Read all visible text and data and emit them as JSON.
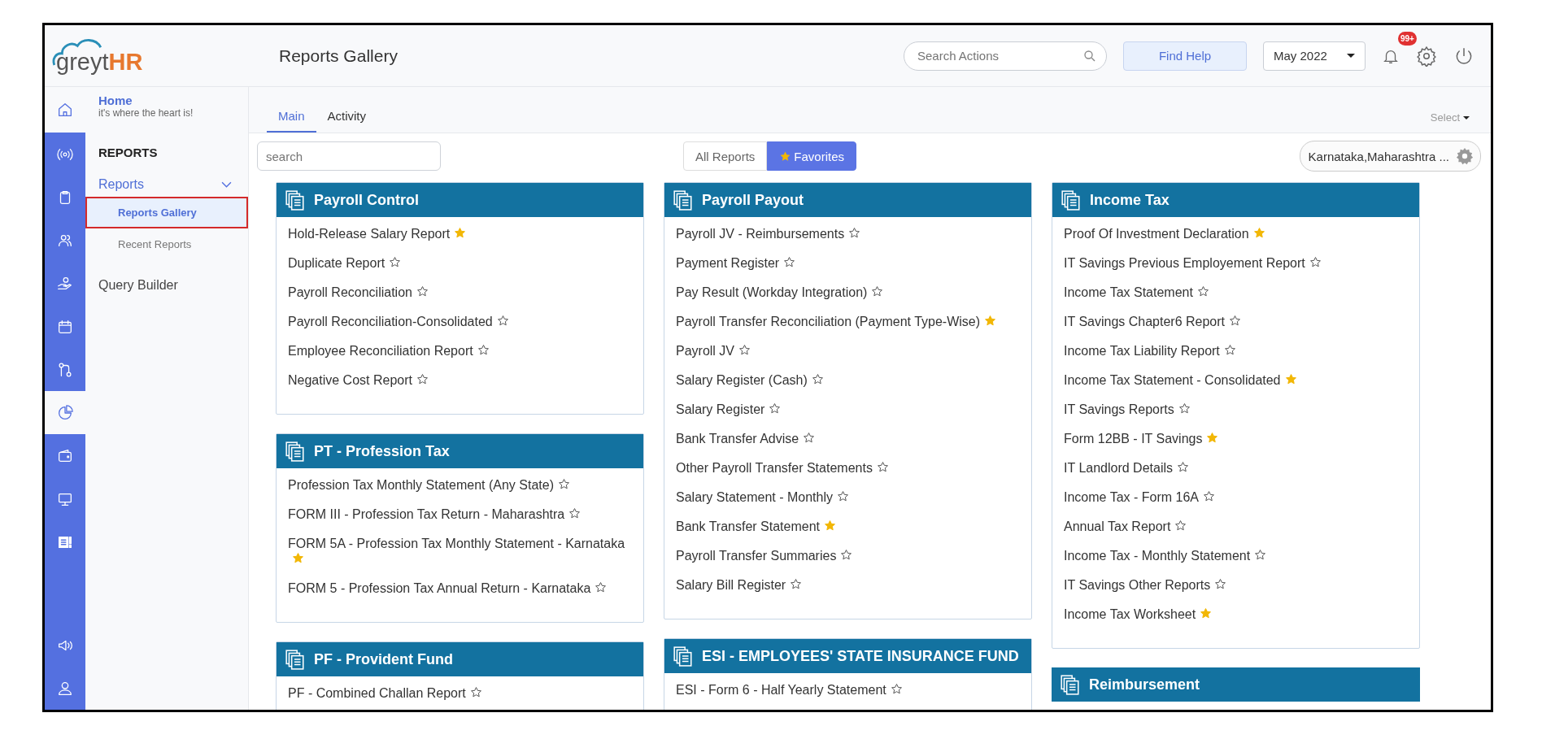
{
  "logo": {
    "part_a": "greyt",
    "part_b": "HR"
  },
  "header": {
    "title": "Reports Gallery",
    "search_placeholder": "Search Actions",
    "help_button": "Find Help",
    "period": "May 2022",
    "notification_badge": "99+"
  },
  "rail_home": {
    "kind": "home"
  },
  "rail": [
    {
      "kind": "broadcast",
      "selected": false
    },
    {
      "kind": "clipboard",
      "selected": false
    },
    {
      "kind": "people",
      "selected": false
    },
    {
      "kind": "hand",
      "selected": false
    },
    {
      "kind": "calendar",
      "selected": false
    },
    {
      "kind": "route",
      "selected": false
    },
    {
      "kind": "pie",
      "selected": true
    },
    {
      "kind": "wallet",
      "selected": false
    },
    {
      "kind": "monitor",
      "selected": false
    },
    {
      "kind": "news",
      "selected": false
    }
  ],
  "rail_bottom": [
    {
      "kind": "megaphone"
    },
    {
      "kind": "user"
    }
  ],
  "sidebar": {
    "home_title": "Home",
    "home_subtitle": "it's where the heart is!",
    "section": "REPORTS",
    "menu": {
      "label": "Reports",
      "expanded": true,
      "children": [
        {
          "label": "Reports Gallery",
          "selected": true
        },
        {
          "label": "Recent Reports",
          "selected": false
        }
      ]
    },
    "links": [
      "Query Builder"
    ]
  },
  "tabs": [
    {
      "label": "Main",
      "selected": true
    },
    {
      "label": "Activity",
      "selected": false
    }
  ],
  "select_menu": "Select",
  "filters": {
    "search_placeholder": "search",
    "toggle": [
      {
        "label": "All Reports",
        "selected": false
      },
      {
        "label": "Favorites",
        "selected": true
      }
    ],
    "location": "Karnataka,Maharashtra ..."
  },
  "columns": [
    [
      {
        "title": "Payroll Control",
        "reports": [
          {
            "name": "Hold-Release Salary Report",
            "favorite": true
          },
          {
            "name": "Duplicate Report",
            "favorite": false
          },
          {
            "name": "Payroll Reconciliation",
            "favorite": false
          },
          {
            "name": "Payroll Reconciliation-Consolidated",
            "favorite": false
          },
          {
            "name": "Employee Reconciliation Report",
            "favorite": false
          },
          {
            "name": "Negative Cost Report",
            "favorite": false
          }
        ]
      },
      {
        "title": "PT - Profession Tax",
        "reports": [
          {
            "name": "Profession Tax Monthly Statement (Any State)",
            "favorite": false
          },
          {
            "name": "FORM III - Profession Tax Return - Maharashtra",
            "favorite": false
          },
          {
            "name": "FORM 5A - Profession Tax Monthly Statement - Karnataka",
            "favorite": true
          },
          {
            "name": "FORM 5 - Profession Tax Annual Return - Karnataka",
            "favorite": false
          }
        ]
      },
      {
        "title": "PF - Provident Fund",
        "reports": [
          {
            "name": "PF - Combined Challan Report",
            "favorite": false
          }
        ]
      }
    ],
    [
      {
        "title": "Payroll Payout",
        "reports": [
          {
            "name": "Payroll JV - Reimbursements",
            "favorite": false
          },
          {
            "name": "Payment Register",
            "favorite": false
          },
          {
            "name": "Pay Result (Workday Integration)",
            "favorite": false
          },
          {
            "name": "Payroll Transfer Reconciliation (Payment Type-Wise)",
            "favorite": true
          },
          {
            "name": "Payroll JV",
            "favorite": false
          },
          {
            "name": "Salary Register (Cash)",
            "favorite": false
          },
          {
            "name": "Salary Register",
            "favorite": false
          },
          {
            "name": "Bank Transfer Advise",
            "favorite": false
          },
          {
            "name": "Other Payroll Transfer Statements",
            "favorite": false
          },
          {
            "name": "Salary Statement - Monthly",
            "favorite": false
          },
          {
            "name": "Bank Transfer Statement",
            "favorite": true
          },
          {
            "name": "Payroll Transfer Summaries",
            "favorite": false
          },
          {
            "name": "Salary Bill Register",
            "favorite": false
          }
        ]
      },
      {
        "title": "ESI - EMPLOYEES' STATE INSURANCE FUND",
        "reports": [
          {
            "name": "ESI - Form 6 - Half Yearly Statement",
            "favorite": false
          }
        ]
      }
    ],
    [
      {
        "title": "Income Tax",
        "reports": [
          {
            "name": "Proof Of Investment Declaration",
            "favorite": true
          },
          {
            "name": "IT Savings Previous Employement Report",
            "favorite": false
          },
          {
            "name": "Income Tax Statement",
            "favorite": false
          },
          {
            "name": "IT Savings Chapter6 Report",
            "favorite": false
          },
          {
            "name": "Income Tax Liability Report",
            "favorite": false
          },
          {
            "name": "Income Tax Statement - Consolidated",
            "favorite": true
          },
          {
            "name": "IT Savings Reports",
            "favorite": false
          },
          {
            "name": "Form 12BB - IT Savings",
            "favorite": true
          },
          {
            "name": "IT Landlord Details",
            "favorite": false
          },
          {
            "name": "Income Tax - Form 16A",
            "favorite": false
          },
          {
            "name": "Annual Tax Report",
            "favorite": false
          },
          {
            "name": "Income Tax - Monthly Statement",
            "favorite": false
          },
          {
            "name": "IT Savings Other Reports",
            "favorite": false
          },
          {
            "name": "Income Tax Worksheet",
            "favorite": true
          }
        ]
      },
      {
        "title": "Reimbursement"
      }
    ]
  ]
}
